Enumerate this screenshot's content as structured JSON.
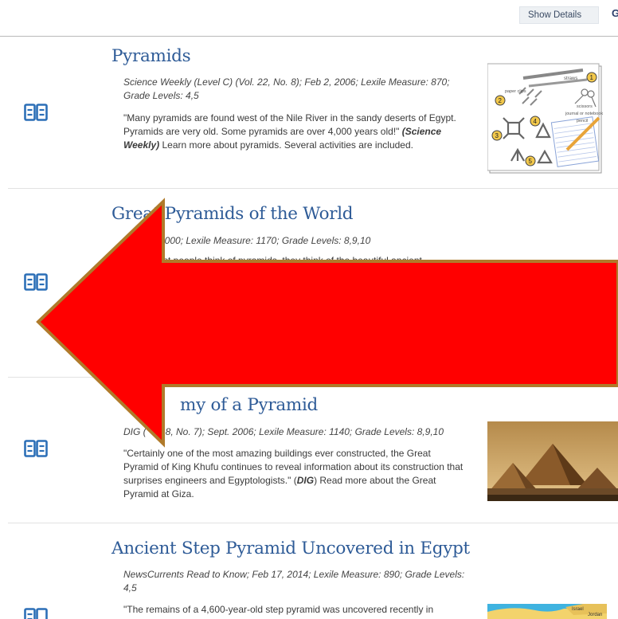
{
  "toolbar": {
    "show_details_label": "Show Details",
    "next_label": "G"
  },
  "results": [
    {
      "title": "Pyramids",
      "meta": "Science Weekly (Level C) (Vol. 22, No. 8); Feb 2, 2006; Lexile Measure: 870; Grade Levels: 4,5",
      "desc_pre": "\"Many pyramids are found west of the Nile River in the sandy deserts of Egypt. Pyramids are very old. Some pyramids are over 4,000 years old!\" ",
      "desc_bold": "(Science Weekly)",
      "desc_post": " Learn more about pyramids. Several activities are included.",
      "thumb_labels": [
        "paper clips",
        "straws",
        "scissors",
        "journal or notebook",
        "pencil",
        "1",
        "2",
        "3",
        "4",
        "5",
        "6"
      ]
    },
    {
      "title": "Great Pyramids of the World",
      "meta": "rch 2000; Lexile Measure: 1170; Grade Levels: 8,9,10",
      "desc_pre": "st people think of pyramids, they think of the beautiful ancient",
      "desc_bold": "",
      "desc_post": ""
    },
    {
      "title": "my of a Pyramid",
      "meta_pre": "DIG (",
      "meta_post": "8, No. 7); Sept. 2006; Lexile Measure: 1140; Grade Levels: 8,9,10",
      "desc_pre": "\"Certainly one of the most amazing buildings ever constructed, the Great Pyramid of King Khufu continues to reveal information about its construction that surprises engineers and Egyptologists.\" (",
      "desc_bold": "DIG",
      "desc_post": ") Read more about the Great Pyramid at Giza."
    },
    {
      "title": "Ancient Step Pyramid Uncovered in Egypt",
      "meta": "NewsCurrents Read to Know; Feb 17, 2014; Lexile Measure: 890; Grade Levels: 4,5",
      "desc_pre": "\"The remains of a 4,600-year-old step pyramid was uncovered recently in",
      "desc_bold": "",
      "desc_post": "",
      "map_labels": [
        "Israel",
        "Jordan"
      ]
    }
  ],
  "colors": {
    "link": "#2e5b97",
    "icon": "#2c6fb7",
    "arrow_fill": "#ff0000",
    "arrow_stroke": "#b07a2a"
  }
}
